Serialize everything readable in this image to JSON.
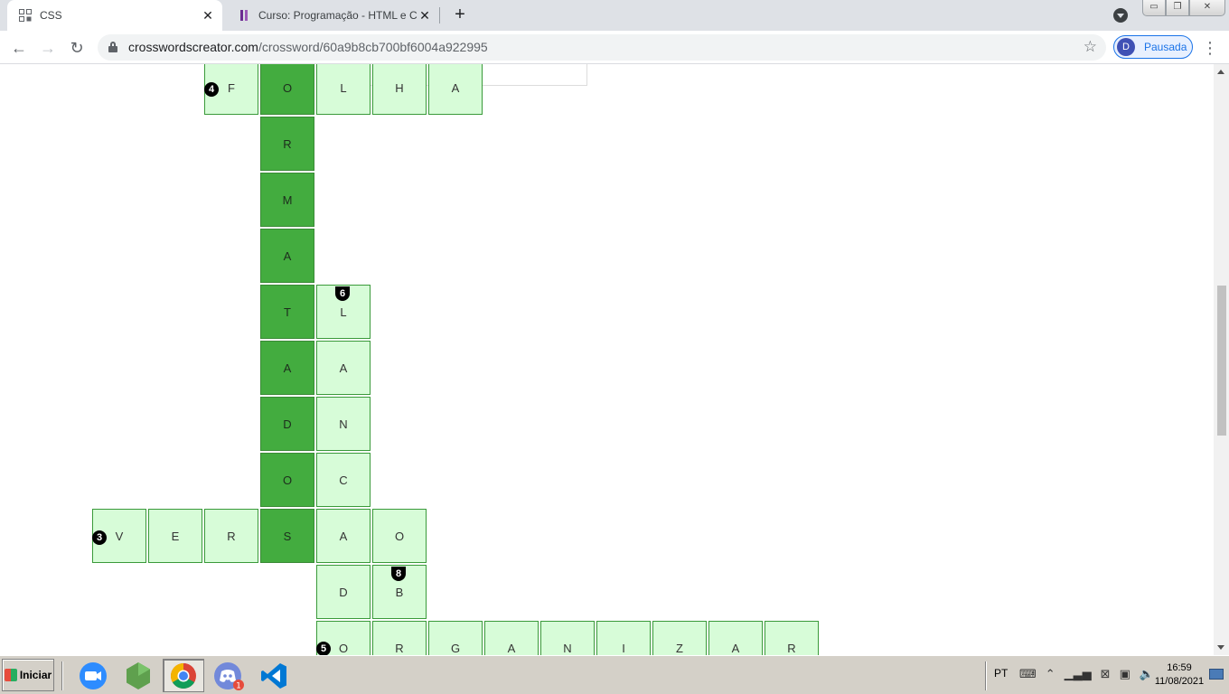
{
  "browser": {
    "tabs": [
      {
        "title": "CSS",
        "active": true
      },
      {
        "title": "Curso: Programação - HTML e CSS",
        "active": false
      }
    ],
    "url_domain": "crosswordscreator.com",
    "url_path": "/crossword/60a9b8cb700bf6004a922995",
    "profile_initial": "D",
    "profile_label": "Pausada"
  },
  "crossword": {
    "colors": {
      "cell": "#d7fcd8",
      "highlight": "#43ac3f",
      "border": "#3a9a3a"
    },
    "numbers": [
      "4",
      "6",
      "3",
      "8",
      "5"
    ],
    "cells": {
      "r0": [
        "F",
        "O",
        "L",
        "H",
        "A"
      ],
      "col_highlight": [
        "R",
        "M",
        "A",
        "T",
        "A",
        "D",
        "O",
        "S"
      ],
      "col6": [
        "L",
        "A",
        "N",
        "C",
        "A",
        "D"
      ],
      "row3": [
        "V",
        "E",
        "R"
      ],
      "r_o": "O",
      "r_b": "B",
      "row5": [
        "O",
        "R",
        "G",
        "A",
        "N",
        "I",
        "Z",
        "A",
        "R"
      ]
    }
  },
  "taskbar": {
    "start_label": "Iniciar",
    "lang": "PT",
    "time": "16:59",
    "date": "11/08/2021",
    "discord_badge": "1"
  }
}
